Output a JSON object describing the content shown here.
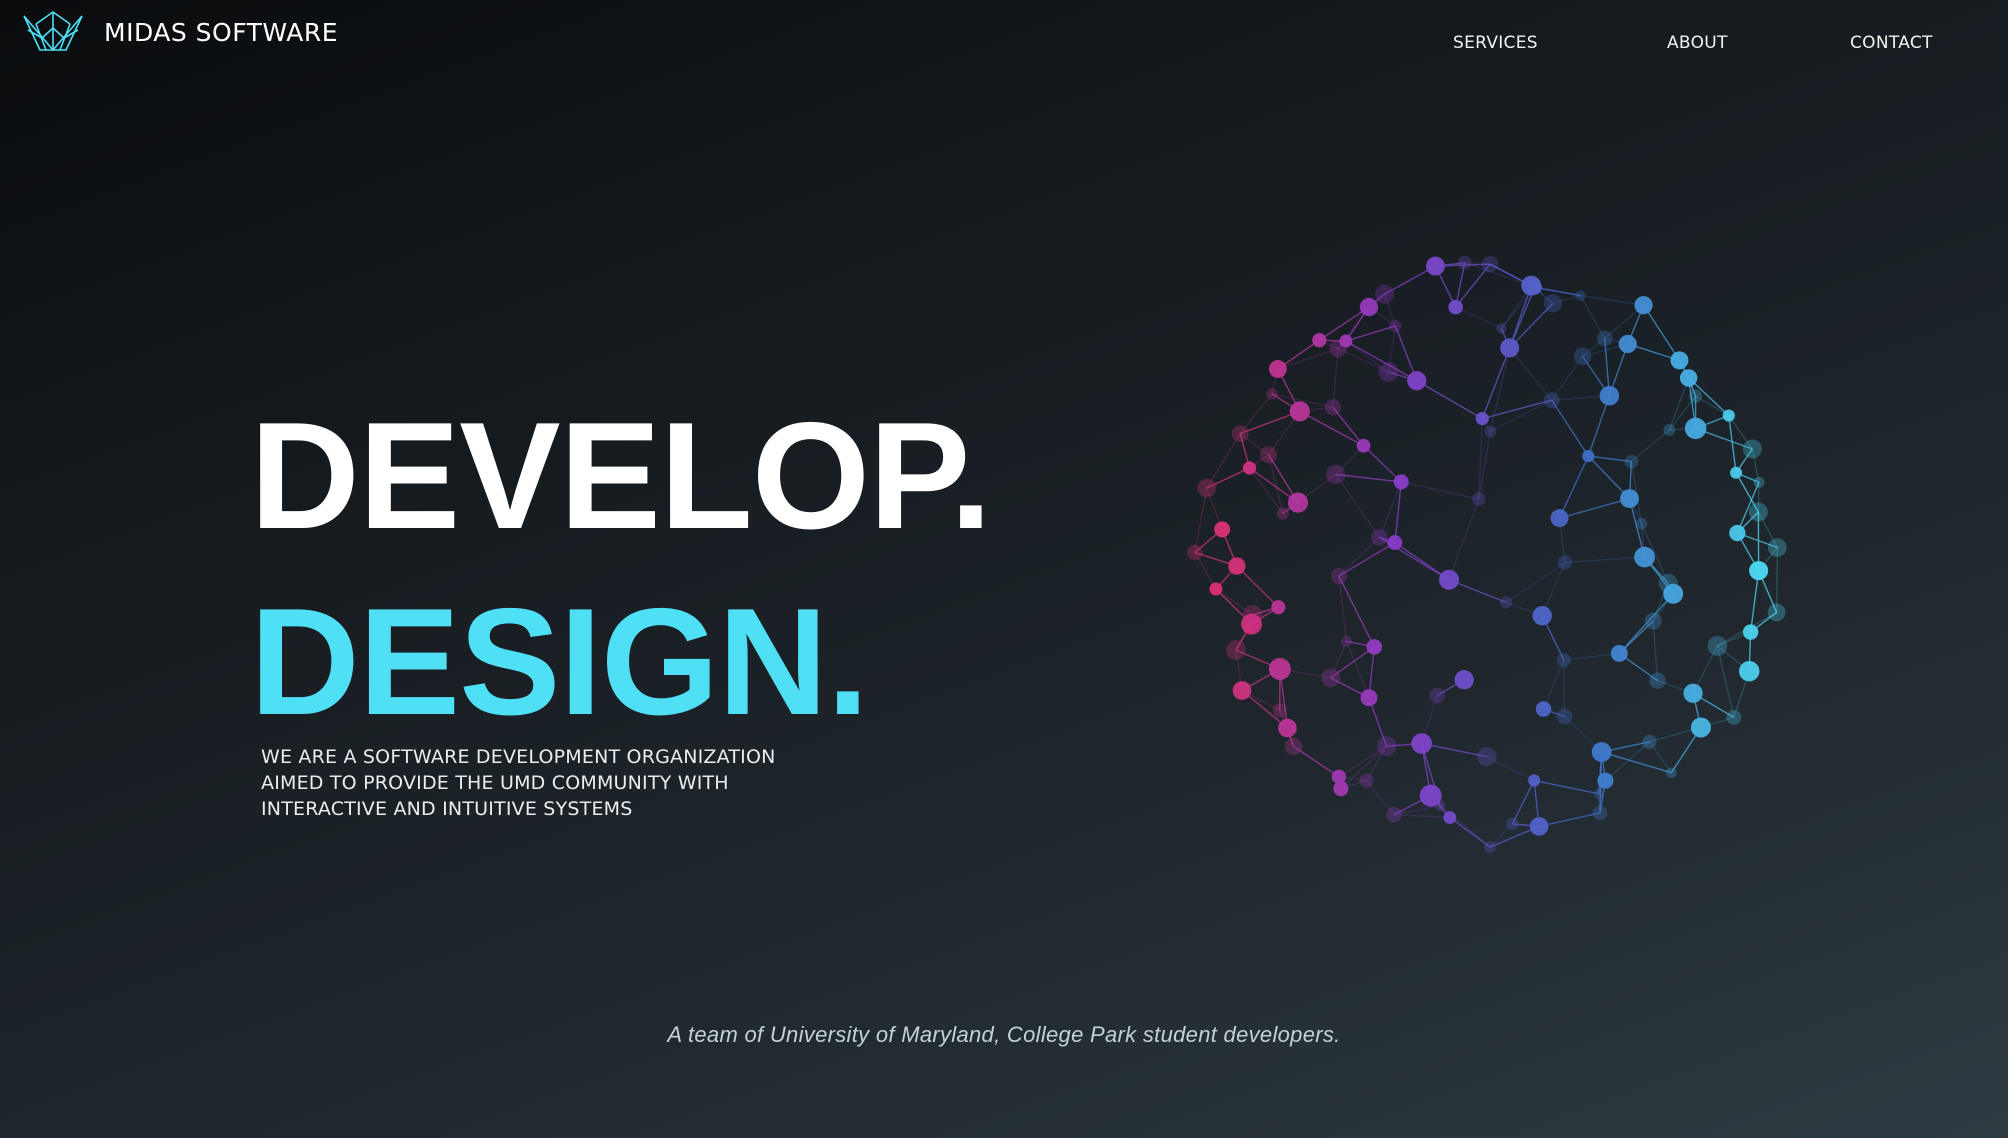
{
  "brand": {
    "name": "MIDAS SOFTWARE",
    "logo_icon": "crown-icon",
    "logo_color": "#4fe0f5"
  },
  "nav": {
    "items": [
      {
        "label": "SERVICES"
      },
      {
        "label": "ABOUT"
      },
      {
        "label": "CONTACT"
      }
    ]
  },
  "hero": {
    "line1": "DEVELOP.",
    "line2": "DESIGN.",
    "line1_color": "#ffffff",
    "line2_color": "#4fe0f5",
    "description": [
      "WE ARE A SOFTWARE DEVELOPMENT ORGANIZATION",
      "AIMED TO PROVIDE THE UMD COMMUNITY WITH",
      "INTERACTIVE AND INTUITIVE SYSTEMS"
    ]
  },
  "graphic": {
    "name": "network-sphere",
    "colors": [
      "#e0306e",
      "#8a3cc8",
      "#3f6fc8",
      "#4fe0f5"
    ]
  },
  "tagline": "A team of University of Maryland, College Park student developers."
}
